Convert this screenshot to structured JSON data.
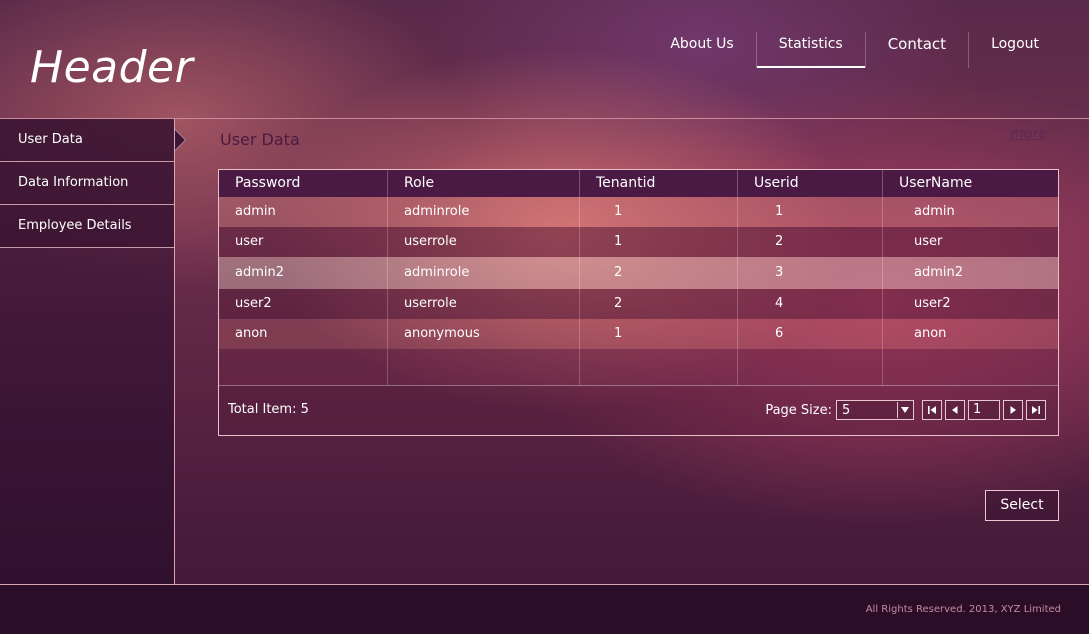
{
  "header": {
    "brand": "Header",
    "nav": [
      {
        "label": "About Us"
      },
      {
        "label": "Statistics",
        "active": true
      },
      {
        "label": "Contact"
      },
      {
        "label": "Logout"
      }
    ]
  },
  "sidebar": {
    "items": [
      {
        "label": "User Data",
        "active": true
      },
      {
        "label": "Data Information"
      },
      {
        "label": "Employee Details"
      }
    ]
  },
  "main": {
    "title": "User Data",
    "more_label": "more",
    "grid": {
      "columns": [
        "Password",
        "Role",
        "Tenantid",
        "Userid",
        "UserName"
      ],
      "rows": [
        [
          "admin",
          "adminrole",
          "1",
          "1",
          "admin"
        ],
        [
          "user",
          "userrole",
          "1",
          "2",
          "user"
        ],
        [
          "admin2",
          "adminrole",
          "2",
          "3",
          "admin2"
        ],
        [
          "user2",
          "userrole",
          "2",
          "4",
          "user2"
        ],
        [
          "anon",
          "anonymous",
          "1",
          "6",
          "anon"
        ]
      ],
      "total_label": "Total Item: 5",
      "page_size_label": "Page Size:",
      "page_size_value": "5",
      "current_page": "1"
    },
    "select_label": "Select"
  },
  "footer": {
    "copyright": "All Rights Reserved. 2013, XYZ Limited"
  }
}
